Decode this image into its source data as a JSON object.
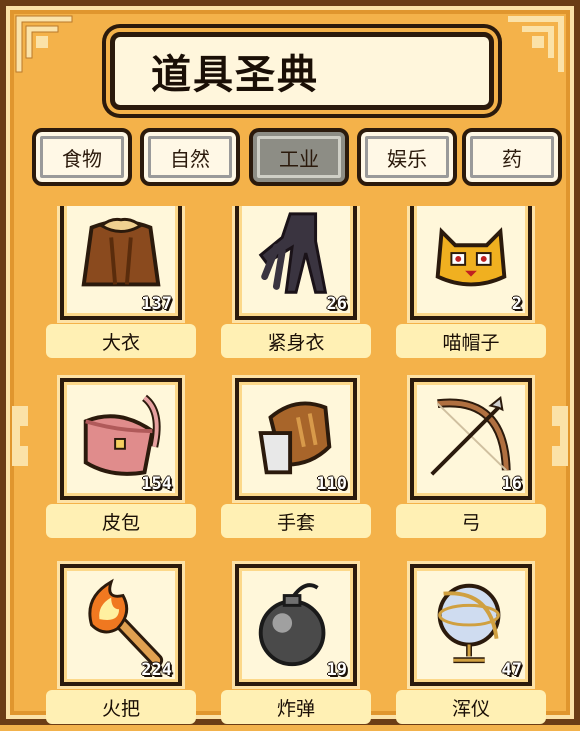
{
  "title": "道具圣典",
  "tabs": [
    {
      "label": "食物",
      "active": false
    },
    {
      "label": "自然",
      "active": false
    },
    {
      "label": "工业",
      "active": true
    },
    {
      "label": "娱乐",
      "active": false
    },
    {
      "label": "药",
      "active": false
    }
  ],
  "items": [
    {
      "name": "大衣",
      "count": "137",
      "icon": "coat-icon"
    },
    {
      "name": "紧身衣",
      "count": "26",
      "icon": "bodysuit-icon"
    },
    {
      "name": "喵帽子",
      "count": "2",
      "icon": "cat-hat-icon"
    },
    {
      "name": "皮包",
      "count": "154",
      "icon": "leather-bag-icon"
    },
    {
      "name": "手套",
      "count": "110",
      "icon": "glove-icon"
    },
    {
      "name": "弓",
      "count": "16",
      "icon": "bow-icon"
    },
    {
      "name": "火把",
      "count": "224",
      "icon": "torch-icon"
    },
    {
      "name": "炸弹",
      "count": "19",
      "icon": "bomb-icon"
    },
    {
      "name": "浑仪",
      "count": "47",
      "icon": "armillary-sphere-icon"
    }
  ],
  "colors": {
    "background": "#f4b24a",
    "outline": "#2b1a0c",
    "card": "#fff7da",
    "name_bar": "#fff0b4",
    "active_tab": "#8d8d85"
  }
}
